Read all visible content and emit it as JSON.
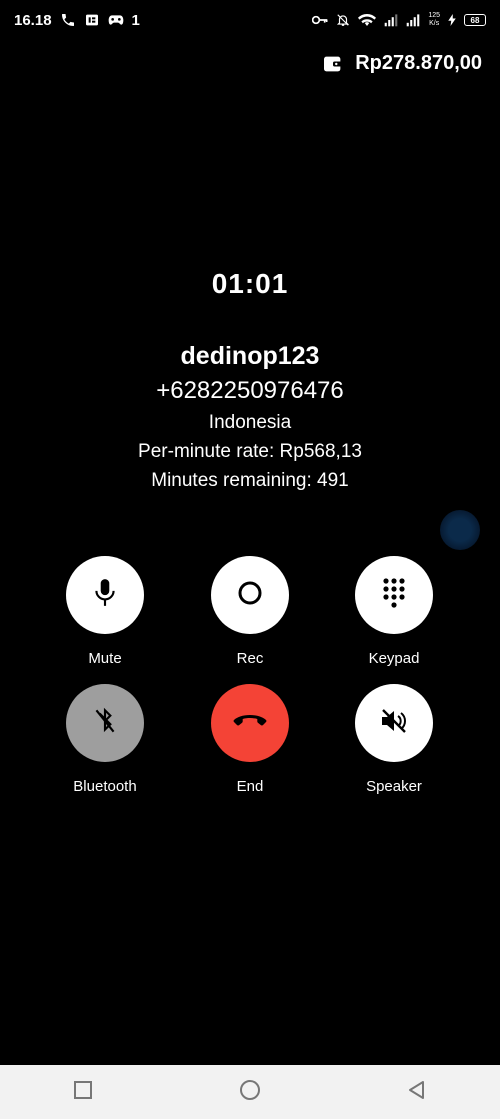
{
  "status_bar": {
    "time": "16.18",
    "sim_label": "1",
    "network_speed_value": "125",
    "network_speed_unit": "K/s",
    "battery_level": "68"
  },
  "balance": {
    "amount": "Rp278.870,00",
    "icon": "wallet-icon"
  },
  "call": {
    "timer": "01:01",
    "contact_name": "dedinop123",
    "phone_number": "+6282250976476",
    "country": "Indonesia",
    "rate_text": "Per-minute rate: Rp568,13",
    "remaining_text": "Minutes remaining: 491"
  },
  "buttons": {
    "mute": "Mute",
    "rec": "Rec",
    "keypad": "Keypad",
    "bluetooth": "Bluetooth",
    "end": "End",
    "speaker": "Speaker"
  },
  "colors": {
    "background": "#000000",
    "end_button": "#f44336",
    "bluetooth_button": "#9e9e9e",
    "navbar": "#f2f2f2"
  }
}
